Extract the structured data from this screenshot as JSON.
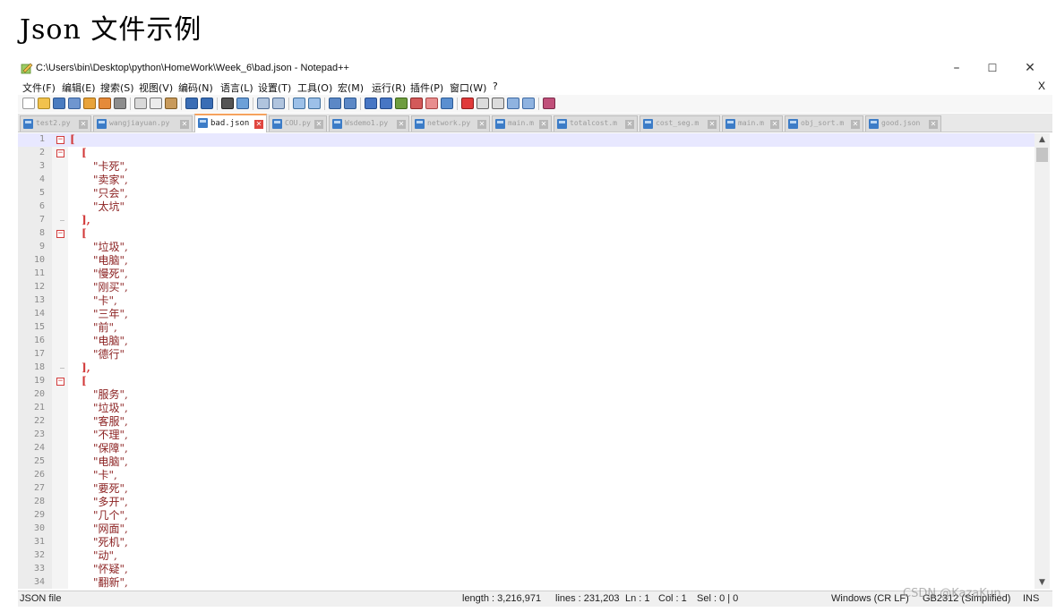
{
  "heading": "Json 文件示例",
  "window": {
    "title": "C:\\Users\\bin\\Desktop\\python\\HomeWork\\Week_6\\bad.json - Notepad++",
    "minimize": "–",
    "maximize": "☐",
    "close": "✕",
    "doc_close": "X"
  },
  "menu": [
    "文件(F)",
    "编辑(E)",
    "搜索(S)",
    "视图(V)",
    "编码(N)",
    "语言(L)",
    "设置(T)",
    "工具(O)",
    "宏(M)",
    "运行(R)",
    "插件(P)",
    "窗口(W)",
    "?"
  ],
  "tabs": [
    {
      "label": "test2.py",
      "active": false
    },
    {
      "label": "wangjiayuan.py",
      "active": false
    },
    {
      "label": "bad.json",
      "active": true
    },
    {
      "label": "COU.py",
      "active": false
    },
    {
      "label": "Wsdemo1.py",
      "active": false
    },
    {
      "label": "network.py",
      "active": false
    },
    {
      "label": "main.m",
      "active": false
    },
    {
      "label": "totalcost.m",
      "active": false
    },
    {
      "label": "cost_seg.m",
      "active": false
    },
    {
      "label": "main.m",
      "active": false
    },
    {
      "label": "obj_sort.m",
      "active": false
    },
    {
      "label": "good.json",
      "active": false
    }
  ],
  "editor": {
    "lines": [
      {
        "n": "1",
        "text": "[",
        "kind": "op",
        "indent": 0,
        "fold": "box"
      },
      {
        "n": "2",
        "text": "[",
        "kind": "op",
        "indent": 1,
        "fold": "box"
      },
      {
        "n": "3",
        "text": "\"卡死\",",
        "kind": "str",
        "indent": 2,
        "fold": ""
      },
      {
        "n": "4",
        "text": "\"卖家\",",
        "kind": "str",
        "indent": 2,
        "fold": ""
      },
      {
        "n": "5",
        "text": "\"只会\",",
        "kind": "str",
        "indent": 2,
        "fold": ""
      },
      {
        "n": "6",
        "text": "\"太坑\"",
        "kind": "str",
        "indent": 2,
        "fold": ""
      },
      {
        "n": "7",
        "text": "],",
        "kind": "op",
        "indent": 1,
        "fold": "end"
      },
      {
        "n": "8",
        "text": "[",
        "kind": "op",
        "indent": 1,
        "fold": "box"
      },
      {
        "n": "9",
        "text": "\"垃圾\",",
        "kind": "str",
        "indent": 2,
        "fold": ""
      },
      {
        "n": "10",
        "text": "\"电脑\",",
        "kind": "str",
        "indent": 2,
        "fold": ""
      },
      {
        "n": "11",
        "text": "\"慢死\",",
        "kind": "str",
        "indent": 2,
        "fold": ""
      },
      {
        "n": "12",
        "text": "\"刚买\",",
        "kind": "str",
        "indent": 2,
        "fold": ""
      },
      {
        "n": "13",
        "text": "\"卡\",",
        "kind": "str",
        "indent": 2,
        "fold": ""
      },
      {
        "n": "14",
        "text": "\"三年\",",
        "kind": "str",
        "indent": 2,
        "fold": ""
      },
      {
        "n": "15",
        "text": "\"前\",",
        "kind": "str",
        "indent": 2,
        "fold": ""
      },
      {
        "n": "16",
        "text": "\"电脑\",",
        "kind": "str",
        "indent": 2,
        "fold": ""
      },
      {
        "n": "17",
        "text": "\"德行\"",
        "kind": "str",
        "indent": 2,
        "fold": ""
      },
      {
        "n": "18",
        "text": "],",
        "kind": "op",
        "indent": 1,
        "fold": "end"
      },
      {
        "n": "19",
        "text": "[",
        "kind": "op",
        "indent": 1,
        "fold": "box"
      },
      {
        "n": "20",
        "text": "\"服务\",",
        "kind": "str",
        "indent": 2,
        "fold": ""
      },
      {
        "n": "21",
        "text": "\"垃圾\",",
        "kind": "str",
        "indent": 2,
        "fold": ""
      },
      {
        "n": "22",
        "text": "\"客服\",",
        "kind": "str",
        "indent": 2,
        "fold": ""
      },
      {
        "n": "23",
        "text": "\"不理\",",
        "kind": "str",
        "indent": 2,
        "fold": ""
      },
      {
        "n": "24",
        "text": "\"保障\",",
        "kind": "str",
        "indent": 2,
        "fold": ""
      },
      {
        "n": "25",
        "text": "\"电脑\",",
        "kind": "str",
        "indent": 2,
        "fold": ""
      },
      {
        "n": "26",
        "text": "\"卡\",",
        "kind": "str",
        "indent": 2,
        "fold": ""
      },
      {
        "n": "27",
        "text": "\"要死\",",
        "kind": "str",
        "indent": 2,
        "fold": ""
      },
      {
        "n": "28",
        "text": "\"多开\",",
        "kind": "str",
        "indent": 2,
        "fold": ""
      },
      {
        "n": "29",
        "text": "\"几个\",",
        "kind": "str",
        "indent": 2,
        "fold": ""
      },
      {
        "n": "30",
        "text": "\"网面\",",
        "kind": "str",
        "indent": 2,
        "fold": ""
      },
      {
        "n": "31",
        "text": "\"死机\",",
        "kind": "str",
        "indent": 2,
        "fold": ""
      },
      {
        "n": "32",
        "text": "\"动\",",
        "kind": "str",
        "indent": 2,
        "fold": ""
      },
      {
        "n": "33",
        "text": "\"怀疑\",",
        "kind": "str",
        "indent": 2,
        "fold": ""
      },
      {
        "n": "34",
        "text": "\"翻新\",",
        "kind": "str",
        "indent": 2,
        "fold": ""
      }
    ]
  },
  "status": {
    "file_type": "JSON file",
    "length": "length : 3,216,971",
    "lines": "lines : 231,203",
    "ln": "Ln : 1",
    "col": "Col : 1",
    "sel": "Sel : 0 | 0",
    "eol": "Windows (CR LF)",
    "encoding": "GB2312 (Simplified)",
    "ins": "INS"
  },
  "watermark": "CSDN @KazaKun"
}
